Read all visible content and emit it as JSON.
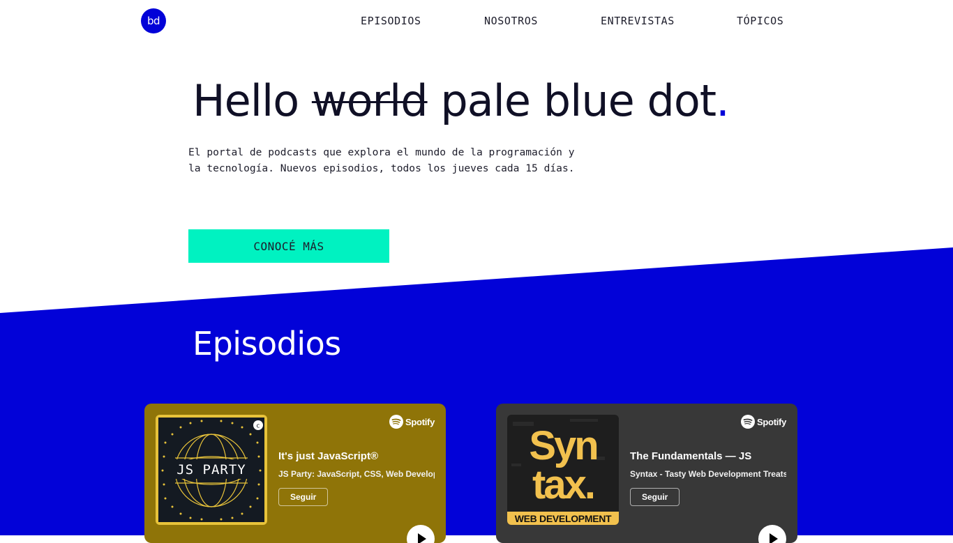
{
  "header": {
    "logo_text": "bd",
    "nav": [
      "EPISODIOS",
      "NOSOTROS",
      "ENTREVISTAS",
      "TÓPICOS"
    ]
  },
  "hero": {
    "title_start": "Hello",
    "title_struck": "world",
    "title_end": "pale blue dot",
    "title_dot": ".",
    "description_lines": [
      "El portal de podcasts que explora el mundo de la programación y",
      "la tecnología. Nuevos episodios, todos los jueves cada 15 días."
    ],
    "cta_label": "CONOCÉ MÁS"
  },
  "episodes": {
    "heading": "Episodios",
    "cards": [
      {
        "cover_text": "JS PARTY",
        "cover_badge": "c",
        "brand": "Spotify",
        "title": "It's just JavaScript®",
        "show": "JS Party: JavaScript, CSS, Web Development",
        "follow_label": "Seguir",
        "play_icon": "play-icon"
      },
      {
        "cover_text_line1": "Syn",
        "cover_text_line2": "tax.",
        "cover_text_line3": "WEB DEVELOPMENT",
        "brand": "Spotify",
        "title": "The Fundamentals — JS",
        "show": "Syntax - Tasty Web Development Treats",
        "follow_label": "Seguir",
        "play_icon": "play-icon"
      }
    ]
  },
  "colors": {
    "brand_blue": "#0202d8",
    "cta_mint": "#00f2c1",
    "card_gold": "#8f7408",
    "card_dark": "#383838",
    "js_party_gold": "#e8c33a",
    "syntax_yellow": "#f2c14e"
  }
}
